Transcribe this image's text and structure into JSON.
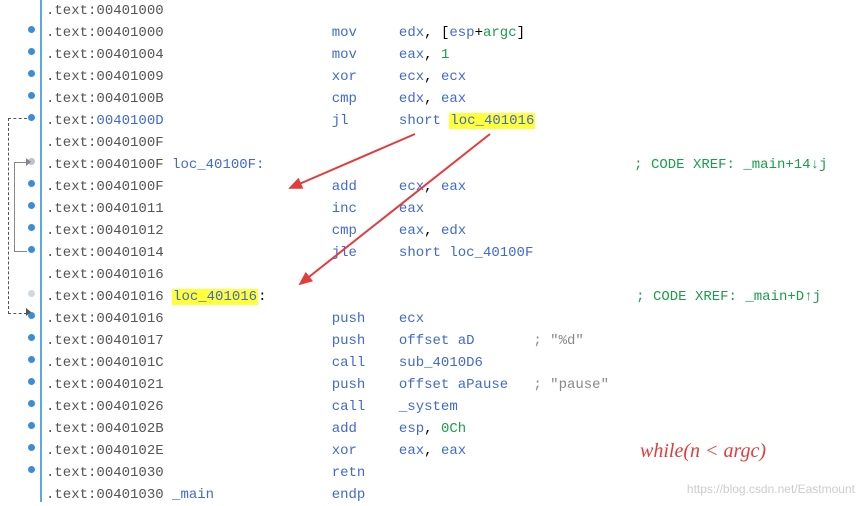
{
  "lines": [
    {
      "addr": "00401000",
      "label": "",
      "mnem": "",
      "ops": []
    },
    {
      "addr": "00401000",
      "label": "",
      "mnem": "mov",
      "ops": [
        {
          "t": "reg",
          "v": "edx"
        },
        {
          "t": "txt",
          "v": ", ["
        },
        {
          "t": "reg",
          "v": "esp"
        },
        {
          "t": "txt",
          "v": "+"
        },
        {
          "t": "num",
          "v": "argc"
        },
        {
          "t": "txt",
          "v": "]"
        }
      ]
    },
    {
      "addr": "00401004",
      "label": "",
      "mnem": "mov",
      "ops": [
        {
          "t": "reg",
          "v": "eax"
        },
        {
          "t": "txt",
          "v": ", "
        },
        {
          "t": "num",
          "v": "1"
        }
      ]
    },
    {
      "addr": "00401009",
      "label": "",
      "mnem": "xor",
      "ops": [
        {
          "t": "reg",
          "v": "ecx"
        },
        {
          "t": "txt",
          "v": ", "
        },
        {
          "t": "reg",
          "v": "ecx"
        }
      ]
    },
    {
      "addr": "0040100B",
      "label": "",
      "mnem": "cmp",
      "ops": [
        {
          "t": "reg",
          "v": "edx"
        },
        {
          "t": "txt",
          "v": ", "
        },
        {
          "t": "reg",
          "v": "eax"
        }
      ]
    },
    {
      "addr": "0040100D",
      "addrlink": true,
      "label": "",
      "mnem": "jl",
      "ops": [
        {
          "t": "kw",
          "v": "short"
        },
        {
          "t": "txt",
          "v": " "
        },
        {
          "t": "hl",
          "v": "loc_401016"
        }
      ]
    },
    {
      "addr": "0040100F",
      "label": "",
      "mnem": "",
      "ops": []
    },
    {
      "addr": "0040100F",
      "label": "loc_40100F:",
      "mnem": "",
      "ops": [],
      "comment": "; CODE XREF: _main+14↓j"
    },
    {
      "addr": "0040100F",
      "label": "",
      "mnem": "add",
      "ops": [
        {
          "t": "reg",
          "v": "ecx"
        },
        {
          "t": "txt",
          "v": ", "
        },
        {
          "t": "reg",
          "v": "eax"
        }
      ]
    },
    {
      "addr": "00401011",
      "label": "",
      "mnem": "inc",
      "ops": [
        {
          "t": "reg",
          "v": "eax"
        }
      ]
    },
    {
      "addr": "00401012",
      "label": "",
      "mnem": "cmp",
      "ops": [
        {
          "t": "reg",
          "v": "eax"
        },
        {
          "t": "txt",
          "v": ", "
        },
        {
          "t": "reg",
          "v": "edx"
        }
      ]
    },
    {
      "addr": "00401014",
      "label": "",
      "mnem": "jle",
      "ops": [
        {
          "t": "kw",
          "v": "short"
        },
        {
          "t": "txt",
          "v": " "
        },
        {
          "t": "label",
          "v": "loc_40100F"
        }
      ]
    },
    {
      "addr": "00401016",
      "label": "",
      "mnem": "",
      "ops": []
    },
    {
      "addr": "00401016",
      "label_hl": "loc_401016",
      "label_suffix": ":",
      "mnem": "",
      "ops": [],
      "comment": "; CODE XREF: _main+D↑j"
    },
    {
      "addr": "00401016",
      "label": "",
      "mnem": "push",
      "ops": [
        {
          "t": "reg",
          "v": "ecx"
        }
      ]
    },
    {
      "addr": "00401017",
      "label": "",
      "mnem": "push",
      "ops": [
        {
          "t": "kw",
          "v": "offset"
        },
        {
          "t": "txt",
          "v": " "
        },
        {
          "t": "label",
          "v": "aD"
        }
      ],
      "tail": "; \"%d\""
    },
    {
      "addr": "0040101C",
      "label": "",
      "mnem": "call",
      "ops": [
        {
          "t": "label",
          "v": "sub_4010D6"
        }
      ]
    },
    {
      "addr": "00401021",
      "label": "",
      "mnem": "push",
      "ops": [
        {
          "t": "kw",
          "v": "offset"
        },
        {
          "t": "txt",
          "v": " "
        },
        {
          "t": "label",
          "v": "aPause"
        }
      ],
      "tail": "; \"pause\""
    },
    {
      "addr": "00401026",
      "label": "",
      "mnem": "call",
      "ops": [
        {
          "t": "func",
          "v": "_system"
        }
      ]
    },
    {
      "addr": "0040102B",
      "label": "",
      "mnem": "add",
      "ops": [
        {
          "t": "reg",
          "v": "esp"
        },
        {
          "t": "txt",
          "v": ", "
        },
        {
          "t": "hex",
          "v": "0Ch"
        }
      ]
    },
    {
      "addr": "0040102E",
      "label": "",
      "mnem": "xor",
      "ops": [
        {
          "t": "reg",
          "v": "eax"
        },
        {
          "t": "txt",
          "v": ", "
        },
        {
          "t": "reg",
          "v": "eax"
        }
      ]
    },
    {
      "addr": "00401030",
      "label": "",
      "mnem": "retn",
      "ops": []
    },
    {
      "addr": "00401030",
      "label_func": "_main",
      "mnem": "endp",
      "ops": []
    }
  ],
  "seg": ".text:",
  "annotation": "while(n < argc)",
  "watermark": "https://blog.csdn.net/Eastmount"
}
